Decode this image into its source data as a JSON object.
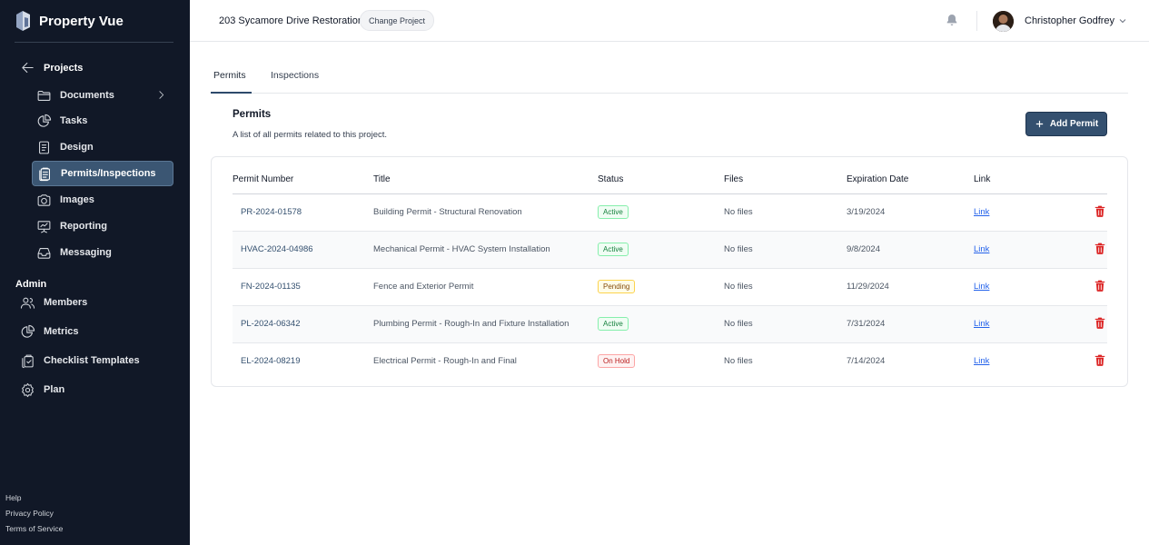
{
  "brand": {
    "name": "Property Vue"
  },
  "sidebar": {
    "projects_label": "Projects",
    "items": [
      {
        "label": "Documents",
        "icon": "folder-icon"
      },
      {
        "label": "Tasks",
        "icon": "pie-chart-icon"
      },
      {
        "label": "Design",
        "icon": "document-icon"
      },
      {
        "label": "Permits/Inspections",
        "icon": "clipboard-icon",
        "active": true
      },
      {
        "label": "Images",
        "icon": "camera-icon"
      },
      {
        "label": "Reporting",
        "icon": "presentation-chart-icon"
      },
      {
        "label": "Messaging",
        "icon": "inbox-icon"
      }
    ],
    "admin_label": "Admin",
    "admin_items": [
      {
        "label": "Members",
        "icon": "users-icon"
      },
      {
        "label": "Metrics",
        "icon": "chart-pie-icon"
      },
      {
        "label": "Checklist Templates",
        "icon": "clipboard-copy-icon"
      },
      {
        "label": "Plan",
        "icon": "gear-icon"
      }
    ],
    "footer": [
      "Help",
      "Privacy Policy",
      "Terms of Service"
    ]
  },
  "header": {
    "project_name": "203 Sycamore Drive Restoration",
    "change_project": "Change Project",
    "user_name": "Christopher Godfrey"
  },
  "tabs": [
    {
      "label": "Permits",
      "active": true
    },
    {
      "label": "Inspections",
      "active": false
    }
  ],
  "permits": {
    "title": "Permits",
    "description": "A list of all permits related to this project.",
    "add_button": "Add Permit",
    "columns": [
      "Permit Number",
      "Title",
      "Status",
      "Files",
      "Expiration Date",
      "Link"
    ],
    "rows": [
      {
        "number": "PR-2024-01578",
        "title": "Building Permit - Structural Renovation",
        "status": "Active",
        "files": "No files",
        "expiration": "3/19/2024",
        "link": "Link"
      },
      {
        "number": "HVAC-2024-04986",
        "title": "Mechanical Permit - HVAC System Installation",
        "status": "Active",
        "files": "No files",
        "expiration": "9/8/2024",
        "link": "Link"
      },
      {
        "number": "FN-2024-01135",
        "title": "Fence and Exterior Permit",
        "status": "Pending",
        "files": "No files",
        "expiration": "11/29/2024",
        "link": "Link"
      },
      {
        "number": "PL-2024-06342",
        "title": "Plumbing Permit - Rough-In and Fixture Installation",
        "status": "Active",
        "files": "No files",
        "expiration": "7/31/2024",
        "link": "Link"
      },
      {
        "number": "EL-2024-08219",
        "title": "Electrical Permit - Rough-In and Final",
        "status": "On Hold",
        "files": "No files",
        "expiration": "7/14/2024",
        "link": "Link"
      }
    ]
  },
  "colors": {
    "sidebar_bg": "#111827",
    "accent": "#34506f",
    "active_status": "#15803d",
    "pending_status": "#854d0e",
    "hold_status": "#b91c1c",
    "delete": "#dc2626"
  }
}
